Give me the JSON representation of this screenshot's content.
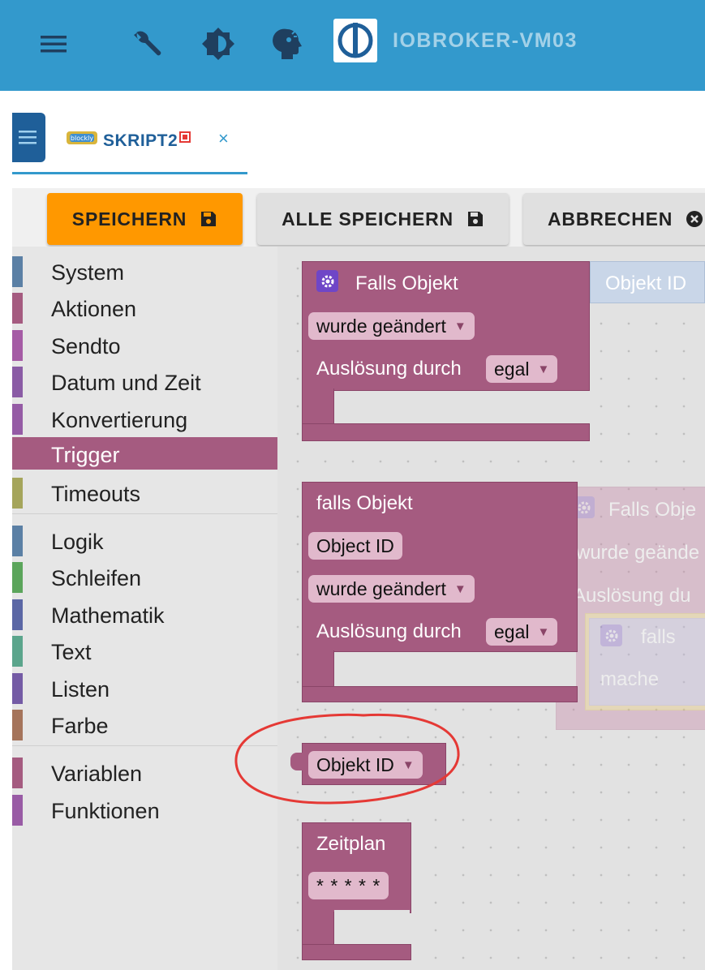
{
  "appbar": {
    "title": "IOBROKER-VM03",
    "icons": [
      "menu-icon",
      "wrench-icon",
      "brightness-icon",
      "expert-mode-icon"
    ],
    "accent": "#3399cc"
  },
  "tab": {
    "badge": "blockly",
    "label": "SKRIPT2",
    "close": "×"
  },
  "toolbar": {
    "save_label": "SPEICHERN",
    "save_all_label": "ALLE SPEICHERN",
    "cancel_label": "ABBRECHEN",
    "save_color": "#ff9800"
  },
  "sidebar": {
    "categories": [
      {
        "label": "System",
        "color": "#5b80a5"
      },
      {
        "label": "Aktionen",
        "color": "#a55b80"
      },
      {
        "label": "Sendto",
        "color": "#a55ba5"
      },
      {
        "label": "Datum und Zeit",
        "color": "#8a5ba5"
      },
      {
        "label": "Konvertierung",
        "color": "#955ba5"
      },
      {
        "label": "Trigger",
        "color": "#a55b80",
        "selected": true
      },
      {
        "label": "Timeouts",
        "color": "#a5a55b"
      },
      {
        "label": "Logik",
        "color": "#5b80a5"
      },
      {
        "label": "Schleifen",
        "color": "#5ba55b"
      },
      {
        "label": "Mathematik",
        "color": "#5b67a5"
      },
      {
        "label": "Text",
        "color": "#5ba58c"
      },
      {
        "label": "Listen",
        "color": "#745ba5"
      },
      {
        "label": "Farbe",
        "color": "#a5745b"
      },
      {
        "label": "Variablen",
        "color": "#a55b80"
      },
      {
        "label": "Funktionen",
        "color": "#995ba5"
      }
    ]
  },
  "workspace": {
    "block1": {
      "title": "Falls Objekt",
      "event": "wurde geändert",
      "trigger_label": "Auslösung durch",
      "trigger_value": "egal",
      "object_label": "Objekt ID"
    },
    "block2": {
      "title": "falls Objekt",
      "object_field": "Object ID",
      "event": "wurde geändert",
      "trigger_label": "Auslösung durch",
      "trigger_value": "egal"
    },
    "ghost": {
      "title": "Falls Obje",
      "event": "wurde geände",
      "trigger": "Auslösung du",
      "inner_if": "falls",
      "inner_do": "mache"
    },
    "object_id_block": "Objekt ID",
    "schedule": {
      "title": "Zeitplan",
      "pattern": "* * * * *"
    },
    "highlight_color": "#e53935"
  }
}
